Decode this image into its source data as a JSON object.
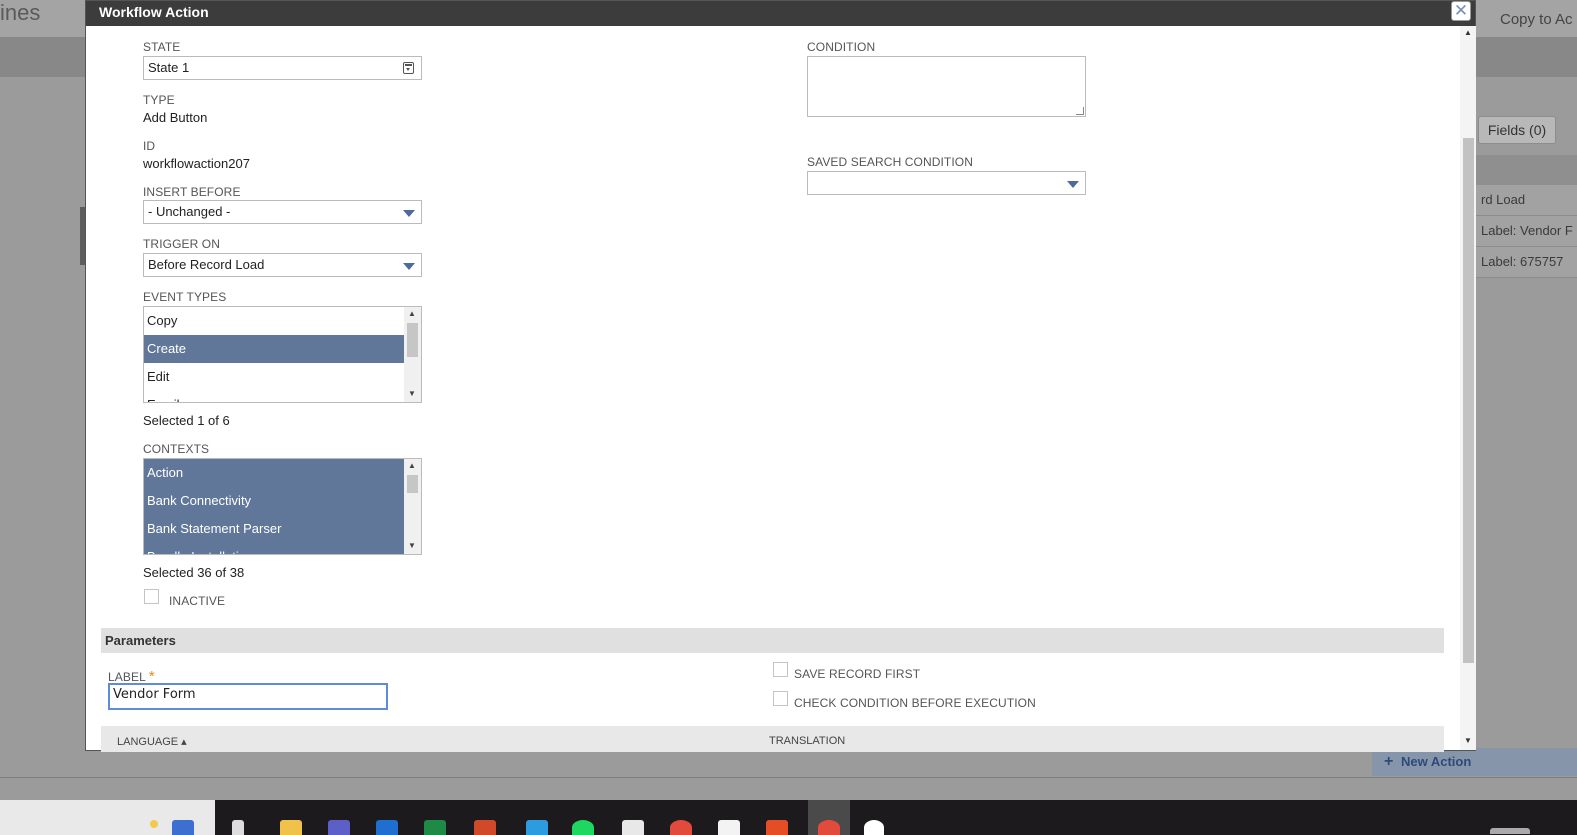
{
  "background": {
    "title_fragment": "ines",
    "copy_button": "Copy to Ac",
    "fields_button": "Fields (0)",
    "rows": [
      "rd Load",
      "Label: Vendor F",
      "Label: 675757"
    ],
    "new_action": "New Action"
  },
  "modal": {
    "title": "Workflow Action",
    "close_label": "✕",
    "fields": {
      "state": {
        "label": "STATE",
        "value": "State 1"
      },
      "type": {
        "label": "TYPE",
        "value": "Add Button"
      },
      "id": {
        "label": "ID",
        "value": "workflowaction207"
      },
      "insert_before": {
        "label": "INSERT BEFORE",
        "value": "- Unchanged -"
      },
      "trigger_on": {
        "label": "TRIGGER ON",
        "value": "Before Record Load"
      },
      "event_types": {
        "label": "EVENT TYPES",
        "items": [
          "Copy",
          "Create",
          "Edit",
          "Email"
        ],
        "selected_index": 1,
        "summary": "Selected 1 of 6"
      },
      "contexts": {
        "label": "CONTEXTS",
        "items": [
          "Action",
          "Bank Connectivity",
          "Bank Statement Parser",
          "Bundle Installation"
        ],
        "summary": "Selected 36 of 38"
      },
      "inactive": {
        "label": "INACTIVE",
        "checked": false
      },
      "condition": {
        "label": "CONDITION",
        "value": ""
      },
      "saved_search_condition": {
        "label": "SAVED SEARCH CONDITION",
        "value": ""
      }
    },
    "parameters": {
      "title": "Parameters",
      "label_field": {
        "label": "LABEL",
        "required_mark": "*",
        "value": "Vendor Form"
      },
      "save_record_first": {
        "label": "SAVE RECORD FIRST",
        "checked": false
      },
      "check_condition": {
        "label": "CHECK CONDITION BEFORE EXECUTION",
        "checked": false
      },
      "table_headers": {
        "language": "LANGUAGE ▴",
        "translation": "TRANSLATION"
      }
    }
  },
  "colors": {
    "header_bg": "#3c3c3c",
    "selected_item": "#607799",
    "accent_arrow": "#4d6a9c",
    "required": "#e08c1a",
    "focus_border": "#5b8ed6"
  }
}
